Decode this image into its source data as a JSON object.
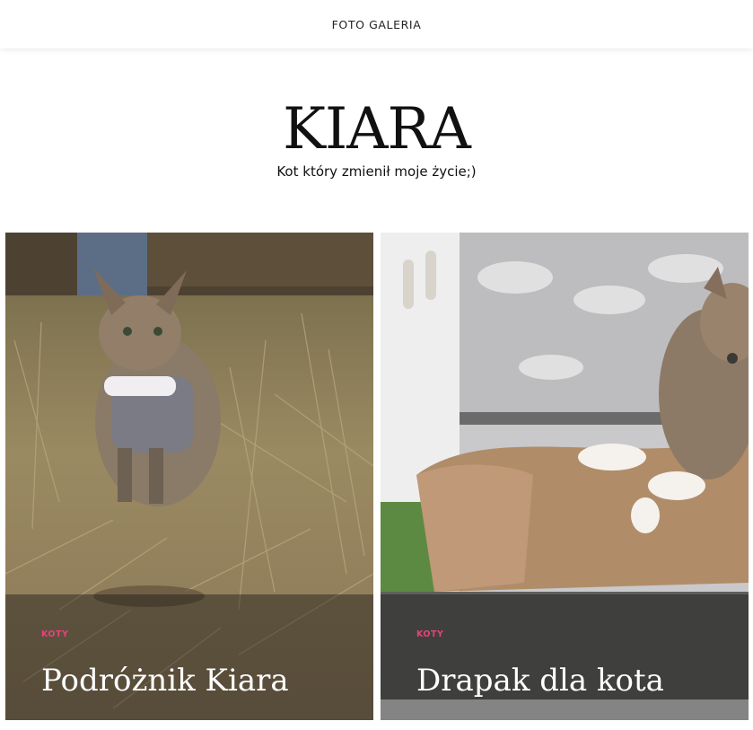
{
  "nav": {
    "label": "FOTO GALERIA"
  },
  "site": {
    "title": "KIARA",
    "tagline": "Kot który zmienił moje życie;)"
  },
  "posts": [
    {
      "category": "KOTY",
      "title": "Podróżnik Kiara"
    },
    {
      "category": "KOTY",
      "title": "Drapak dla kota"
    }
  ],
  "colors": {
    "category_accent": "#e2457a",
    "background": "#ffffff",
    "overlay": "rgba(20,20,20,0.42)"
  }
}
